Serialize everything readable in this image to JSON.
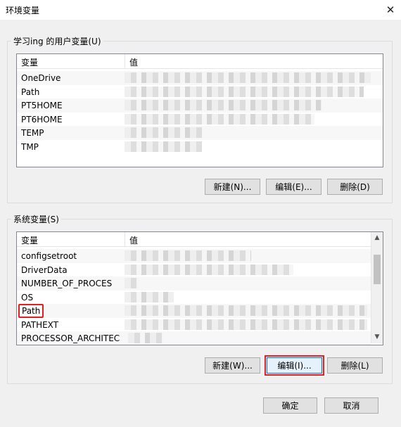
{
  "window": {
    "title": "环境变量",
    "close": "✕"
  },
  "user_vars": {
    "group_label": "学习ing 的用户变量(U)",
    "col_name": "变量",
    "col_value": "值",
    "rows": [
      {
        "name": "OneDrive"
      },
      {
        "name": "Path"
      },
      {
        "name": "PT5HOME"
      },
      {
        "name": "PT6HOME"
      },
      {
        "name": "TEMP"
      },
      {
        "name": "TMP"
      }
    ],
    "buttons": {
      "new": "新建(N)...",
      "edit": "编辑(E)...",
      "delete": "删除(D)"
    }
  },
  "system_vars": {
    "group_label": "系统变量(S)",
    "col_name": "变量",
    "col_value": "值",
    "rows": [
      {
        "name": "configsetroot"
      },
      {
        "name": "DriverData"
      },
      {
        "name": "NUMBER_OF_PROCESSORS"
      },
      {
        "name": "OS"
      },
      {
        "name": "Path"
      },
      {
        "name": "PATHEXT"
      },
      {
        "name": "PROCESSOR_ARCHITECTURE"
      }
    ],
    "buttons": {
      "new": "新建(W)...",
      "edit": "编辑(I)...",
      "delete": "删除(L)"
    },
    "scroll_up": "▲",
    "scroll_down": "▼"
  },
  "footer": {
    "ok": "确定",
    "cancel": "取消"
  },
  "colors": {
    "highlight": "#e02020"
  }
}
